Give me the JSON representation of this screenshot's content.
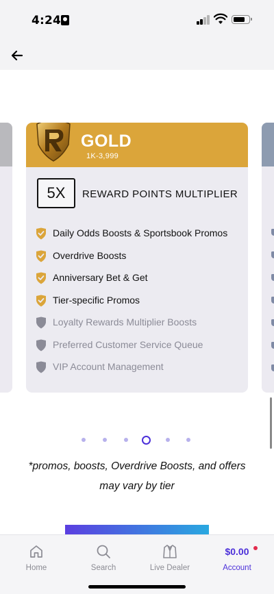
{
  "status_bar": {
    "time": "4:24"
  },
  "tier": {
    "name": "GOLD",
    "range": "1K-3,999",
    "multiplier": "5X",
    "multiplier_label": "REWARD POINTS MULTIPLIER",
    "band_color": "#dba53a",
    "benefits": [
      {
        "label": "Daily Odds Boosts & Sportsbook Promos",
        "included": true
      },
      {
        "label": "Overdrive Boosts",
        "included": true
      },
      {
        "label": "Anniversary Bet & Get",
        "included": true
      },
      {
        "label": "Tier-specific Promos",
        "included": true
      },
      {
        "label": "Loyalty Rewards Multiplier Boosts",
        "included": false
      },
      {
        "label": "Preferred Customer Service Queue",
        "included": false
      },
      {
        "label": "VIP Account Management",
        "included": false
      }
    ]
  },
  "pagination": {
    "total": 6,
    "active_index": 3
  },
  "disclaimer": "*promos, boosts, Overdrive Boosts, and offers may vary by tier",
  "tab_bar": {
    "home": "Home",
    "search": "Search",
    "live_dealer": "Live Dealer",
    "account": "Account",
    "balance": "$0.00"
  },
  "colors": {
    "accent": "#4b2fd9",
    "included_icon": "#dba53a",
    "excluded_icon": "#8b8b97"
  },
  "icons": {
    "back": "arrow-left-icon",
    "home": "home-icon",
    "search": "search-icon",
    "live_dealer": "jacket-icon",
    "benefit_included": "shield-check-icon",
    "benefit_excluded": "shield-icon"
  }
}
